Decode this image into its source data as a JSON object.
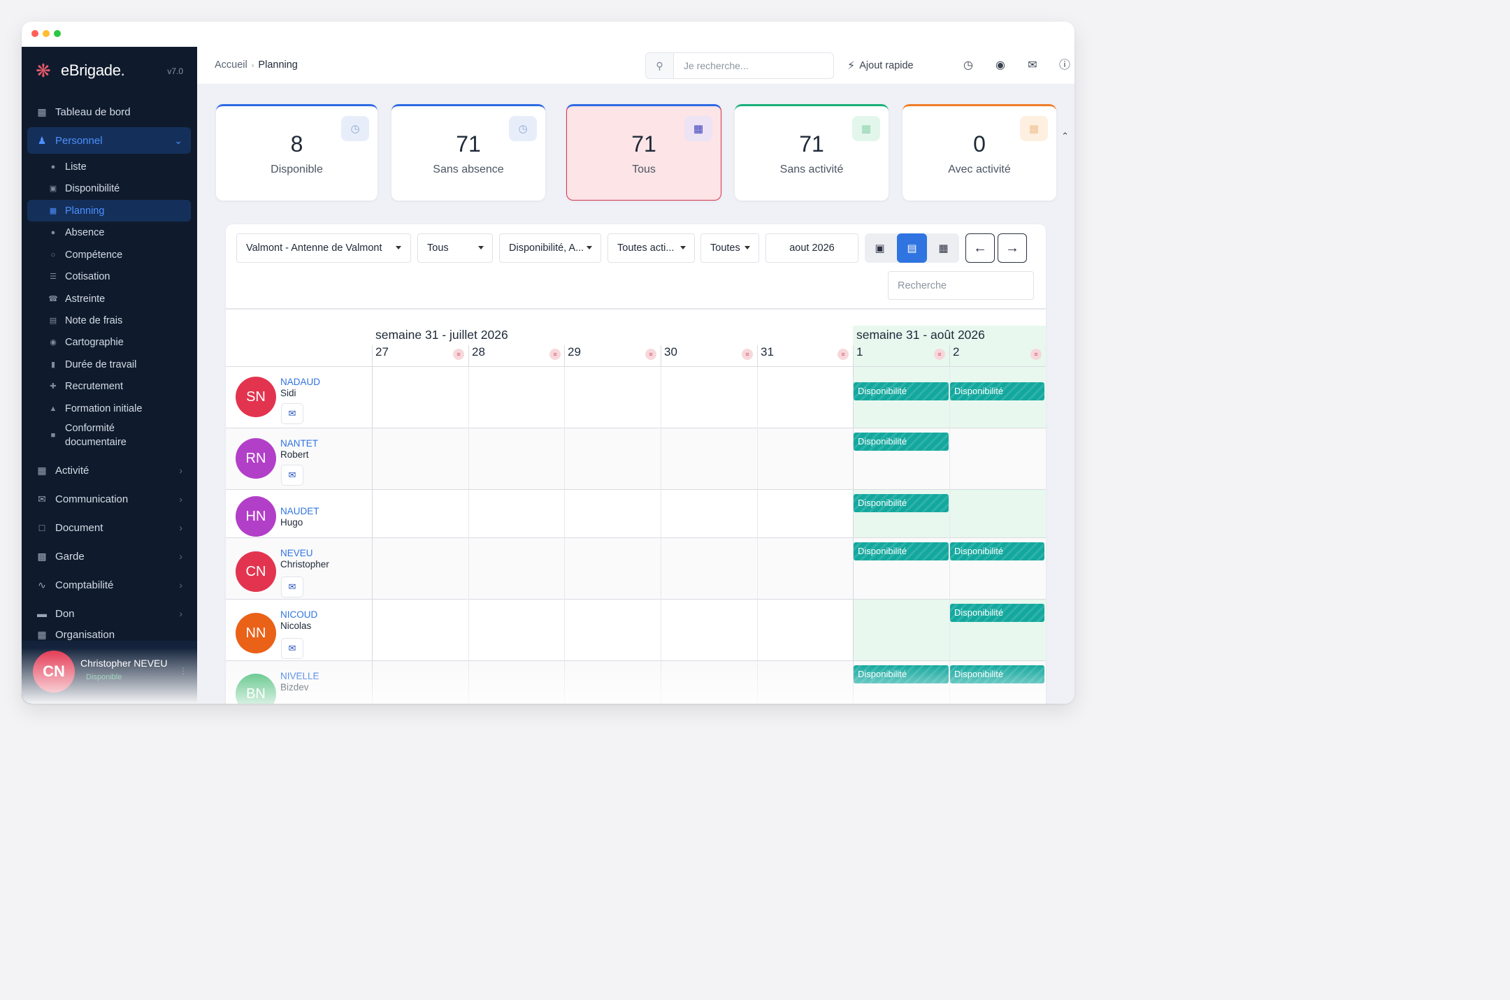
{
  "app": {
    "brand": "eBrigade.",
    "version": "v7.0"
  },
  "sidebar": {
    "items": [
      {
        "label": "Tableau de bord",
        "icon": "dashboard-icon"
      },
      {
        "label": "Personnel",
        "icon": "user-icon"
      },
      {
        "label": "Activité",
        "icon": "calendar-icon"
      },
      {
        "label": "Communication",
        "icon": "mail-icon"
      },
      {
        "label": "Document",
        "icon": "file-icon"
      },
      {
        "label": "Garde",
        "icon": "clipboard-icon"
      },
      {
        "label": "Comptabilité",
        "icon": "chart-icon"
      },
      {
        "label": "Don",
        "icon": "hand-icon"
      },
      {
        "label": "Organisation",
        "icon": "org-icon"
      }
    ],
    "sub_items": [
      {
        "label": "Liste",
        "icon": "users-icon"
      },
      {
        "label": "Disponibilité",
        "icon": "calendar-check-icon"
      },
      {
        "label": "Planning",
        "icon": "calendar-icon"
      },
      {
        "label": "Absence",
        "icon": "user-minus-icon"
      },
      {
        "label": "Compétence",
        "icon": "award-icon"
      },
      {
        "label": "Cotisation",
        "icon": "coins-icon"
      },
      {
        "label": "Astreinte",
        "icon": "phone-icon"
      },
      {
        "label": "Note de frais",
        "icon": "receipt-icon"
      },
      {
        "label": "Cartographie",
        "icon": "map-pin-icon"
      },
      {
        "label": "Durée de travail",
        "icon": "truck-icon"
      },
      {
        "label": "Recrutement",
        "icon": "user-plus-icon"
      },
      {
        "label": "Formation initiale",
        "icon": "graduation-icon"
      },
      {
        "label": "Conformité documentaire",
        "icon": "file-lock-icon"
      }
    ],
    "user": {
      "initials": "CN",
      "name": "Christopher NEVEU",
      "status": "Disponible"
    }
  },
  "topbar": {
    "breadcrumb": [
      "Accueil",
      "Planning"
    ],
    "search_placeholder": "Je recherche...",
    "quick_add": "Ajout rapide"
  },
  "stats": [
    {
      "value": "8",
      "label": "Disponible"
    },
    {
      "value": "71",
      "label": "Sans absence"
    },
    {
      "value": "71",
      "label": "Tous"
    },
    {
      "value": "71",
      "label": "Sans activité"
    },
    {
      "value": "0",
      "label": "Avec activité"
    }
  ],
  "filters": {
    "section": "Valmont - Antenne de Valmont",
    "personnel": "Tous",
    "types": "Disponibilité, A...",
    "activities": "Toutes acti...",
    "category": "Toutes",
    "month": "aout 2026",
    "search_placeholder": "Recherche"
  },
  "calendar": {
    "weeks": [
      "semaine 31 - juillet 2026",
      "semaine 31 - août 2026"
    ],
    "days": [
      "27",
      "28",
      "29",
      "30",
      "31",
      "1",
      "2"
    ]
  },
  "people": [
    {
      "initials": "SN",
      "last": "NADAUD",
      "first": "Sidi",
      "color": "#e3344f",
      "slots": [
        "Disponibilité",
        "Disponibilité"
      ]
    },
    {
      "initials": "RN",
      "last": "NANTET",
      "first": "Robert",
      "color": "#b23fc8",
      "slots": [
        "Disponibilité",
        ""
      ]
    },
    {
      "initials": "HN",
      "last": "NAUDET",
      "first": "Hugo",
      "color": "#b23fc8",
      "slots": [
        "Disponibilité",
        ""
      ]
    },
    {
      "initials": "CN",
      "last": "NEVEU",
      "first": "Christopher",
      "color": "#e3344f",
      "slots": [
        "Disponibilité",
        "Disponibilité"
      ]
    },
    {
      "initials": "NN",
      "last": "NICOUD",
      "first": "Nicolas",
      "color": "#ea6118",
      "slots": [
        "",
        "Disponibilité"
      ]
    },
    {
      "initials": "BN",
      "last": "NIVELLE",
      "first": "Bizdev",
      "color": "#4fbf7c",
      "slots": [
        "Disponibilité",
        "Disponibilité"
      ]
    }
  ]
}
